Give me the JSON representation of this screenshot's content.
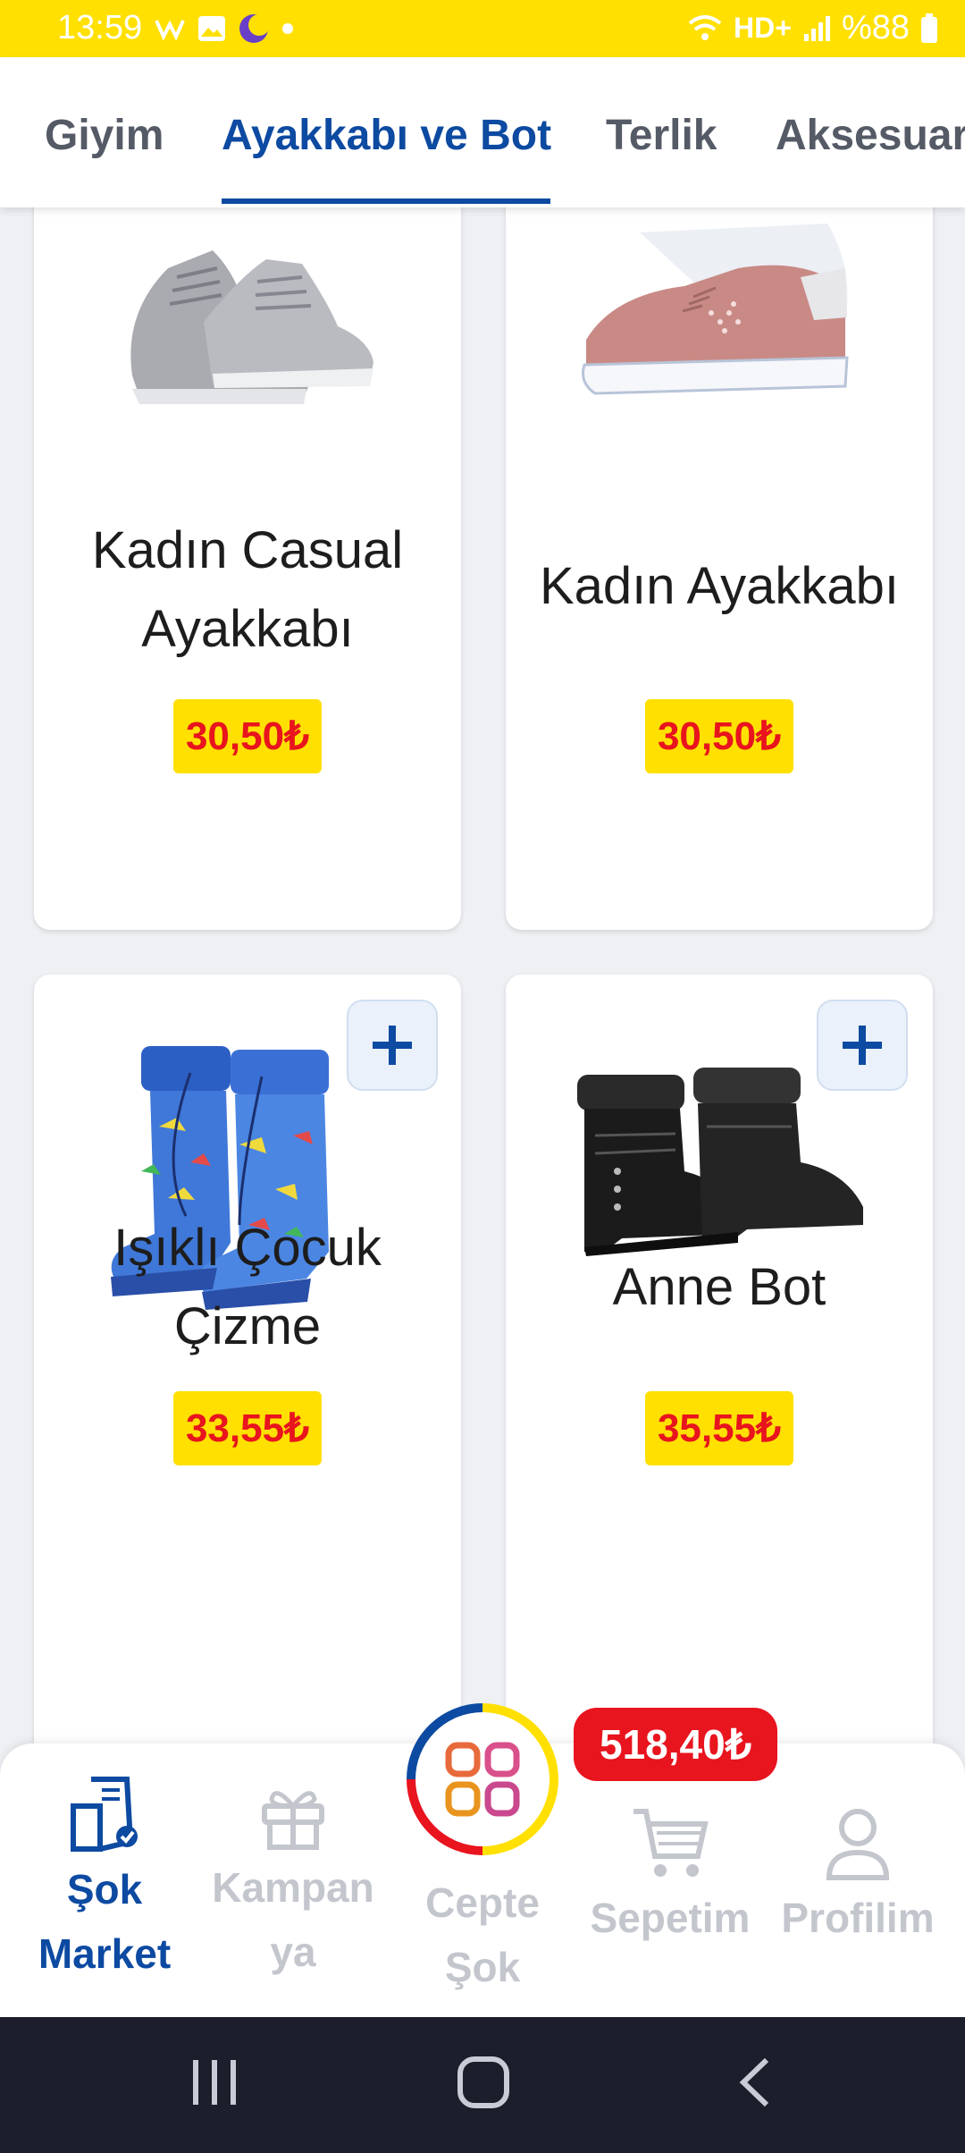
{
  "status_bar": {
    "time": "13:59",
    "battery": "%88",
    "network": "HD+",
    "icons": [
      "whatsapp-icon",
      "gallery-icon",
      "moon-icon",
      "dot-icon",
      "wifi-icon",
      "signal-icon",
      "battery-icon"
    ]
  },
  "tabs": [
    {
      "label": "Giyim"
    },
    {
      "label": "Ayakkabı ve Bot"
    },
    {
      "label": "Terlik"
    },
    {
      "label": "Aksesuar"
    }
  ],
  "products": [
    {
      "name_line1": "Kadın Casual",
      "name_line2": "Ayakkabı",
      "price": "30,50₺",
      "image": "grey-sneaker"
    },
    {
      "name_line1": "Kadın Ayakkabı",
      "name_line2": "",
      "price": "30,50₺",
      "image": "pink-sneaker"
    },
    {
      "name_line1": "Işıklı Çocuk",
      "name_line2": "Çizme",
      "price": "33,55₺",
      "image": "blue-rain-boots"
    },
    {
      "name_line1": "Anne Bot",
      "name_line2": "",
      "price": "35,55₺",
      "image": "black-ankle-boots"
    }
  ],
  "bottom_nav": {
    "items": [
      {
        "line1": "Şok",
        "line2": "Market",
        "icon": "grocery-bag-icon",
        "active": true
      },
      {
        "line1": "Kampan",
        "line2": "ya",
        "icon": "gift-icon",
        "active": false
      },
      {
        "line1": "Cepte",
        "line2": "Şok",
        "icon": "apps-grid-icon",
        "active": false
      },
      {
        "line1": "Sepetim",
        "line2": "",
        "icon": "cart-icon",
        "active": false
      },
      {
        "line1": "Profilim",
        "line2": "",
        "icon": "user-icon",
        "active": false
      }
    ],
    "cart_total": "518,40₺"
  },
  "colors": {
    "accent_blue": "#0d4aa1",
    "brand_yellow": "#ffe000",
    "price_red": "#e8141e",
    "inactive_grey": "#c3c6cd"
  }
}
